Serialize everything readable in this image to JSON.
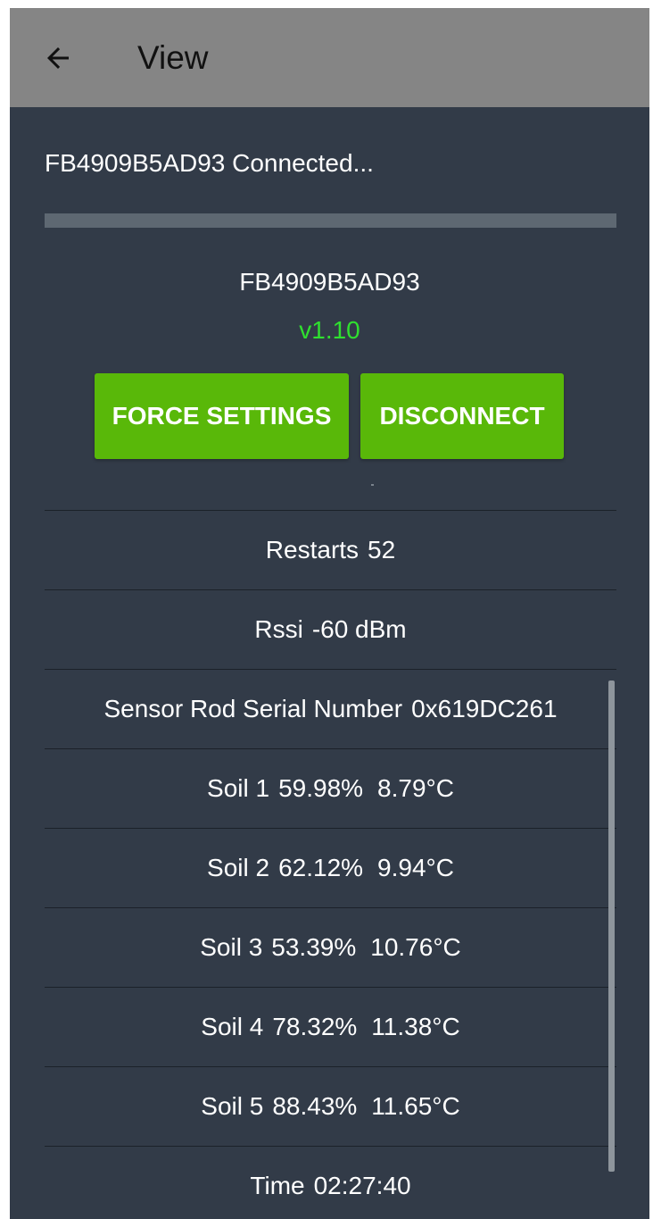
{
  "appbar": {
    "title": "View",
    "back_icon": "arrow-left-icon"
  },
  "status": {
    "text": "FB4909B5AD93 Connected...",
    "progress": 1.0
  },
  "device": {
    "name": "FB4909B5AD93",
    "version": "v1.10",
    "version_color": "#2fe02f"
  },
  "buttons": {
    "force_settings": "FORCE SETTINGS",
    "disconnect": "DISCONNECT",
    "color": "#59b809"
  },
  "readings": [
    {
      "label": "Restarts",
      "value": "52"
    },
    {
      "label": "Rssi",
      "value": "-60 dBm"
    },
    {
      "label": "Sensor Rod Serial Number",
      "value": "0x619DC261"
    },
    {
      "label": "Soil 1",
      "value": "59.98%",
      "value2": "8.79°C"
    },
    {
      "label": "Soil 2",
      "value": "62.12%",
      "value2": "9.94°C"
    },
    {
      "label": "Soil 3",
      "value": "53.39%",
      "value2": "10.76°C"
    },
    {
      "label": "Soil 4",
      "value": "78.32%",
      "value2": "11.38°C"
    },
    {
      "label": "Soil 5",
      "value": "88.43%",
      "value2": "11.65°C"
    },
    {
      "label": "Time",
      "value": "02:27:40"
    }
  ]
}
